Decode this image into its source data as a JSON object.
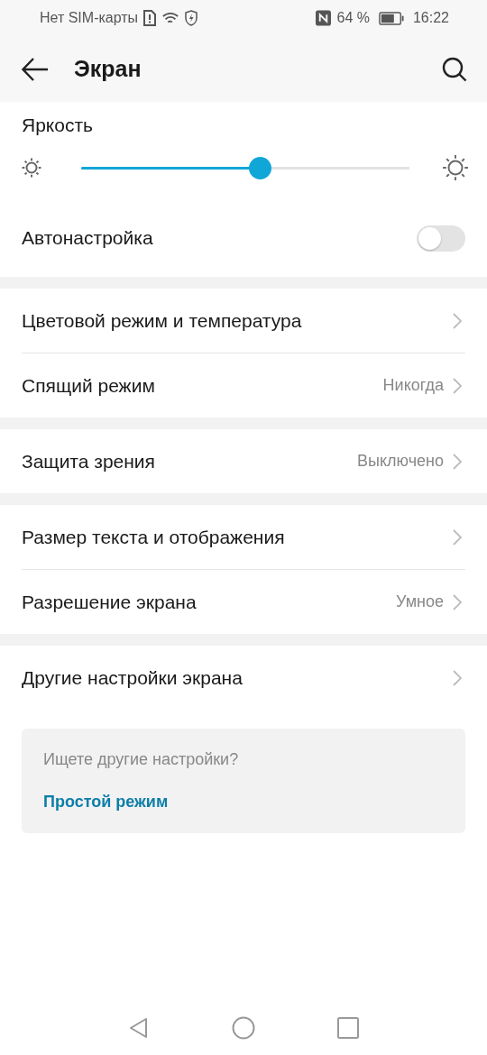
{
  "status_bar": {
    "carrier": "Нет SIM-карты",
    "battery_percent": "64 %",
    "time": "16:22"
  },
  "header": {
    "title": "Экран"
  },
  "brightness": {
    "label": "Яркость",
    "level": 0.545
  },
  "auto": {
    "label": "Автонастройка",
    "on": false
  },
  "groups": [
    {
      "items": [
        {
          "label": "Цветовой режим и температура"
        },
        {
          "label": "Спящий режим",
          "value": "Никогда"
        }
      ]
    },
    {
      "items": [
        {
          "label": "Защита зрения",
          "value": "Выключено"
        }
      ]
    },
    {
      "items": [
        {
          "label": "Размер текста и отображения"
        },
        {
          "label": "Разрешение экрана",
          "value": "Умное"
        }
      ]
    },
    {
      "items": [
        {
          "label": "Другие настройки экрана"
        }
      ]
    }
  ],
  "hint": {
    "question": "Ищете другие настройки?",
    "link": "Простой режим"
  }
}
